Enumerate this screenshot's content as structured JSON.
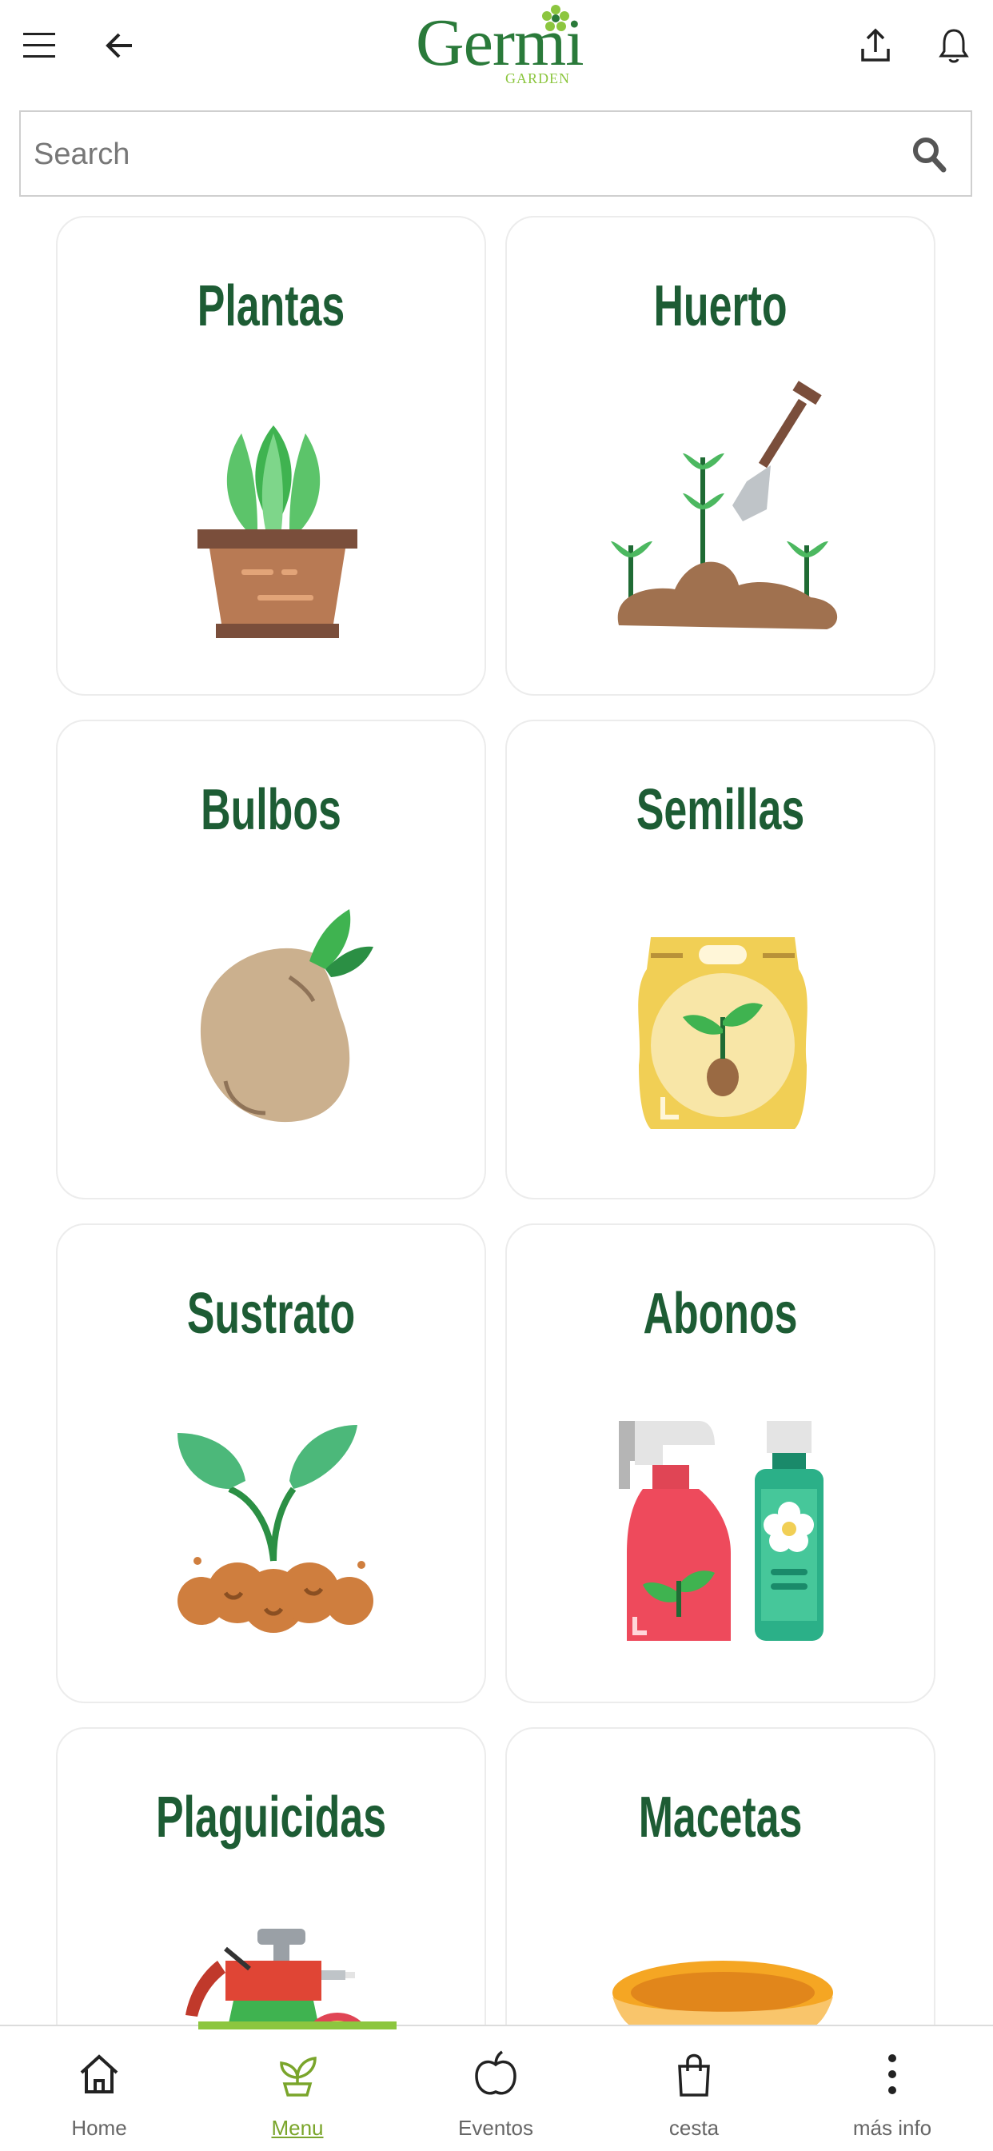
{
  "header": {
    "menu_icon": "hamburger-icon",
    "back_icon": "arrow-left-icon",
    "logo_text": "Germi",
    "logo_sub": "GARDEN",
    "share_icon": "upload-icon",
    "bell_icon": "bell-icon"
  },
  "search": {
    "placeholder": "Search",
    "value": "",
    "icon": "search-icon"
  },
  "categories": [
    {
      "label": "Plantas",
      "icon": "potted-plant-icon"
    },
    {
      "label": "Huerto",
      "icon": "garden-shovel-icon"
    },
    {
      "label": "Bulbos",
      "icon": "bulb-icon"
    },
    {
      "label": "Semillas",
      "icon": "seed-bag-icon"
    },
    {
      "label": "Sustrato",
      "icon": "sprout-soil-icon"
    },
    {
      "label": "Abonos",
      "icon": "fertilizer-bottles-icon"
    },
    {
      "label": "Plaguicidas",
      "icon": "pesticide-sprayer-icon"
    },
    {
      "label": "Macetas",
      "icon": "pot-icon"
    }
  ],
  "bottom_nav": {
    "items": [
      {
        "label": "Home",
        "icon": "home-icon"
      },
      {
        "label": "Menu",
        "icon": "sprout-icon"
      },
      {
        "label": "Eventos",
        "icon": "apple-icon"
      },
      {
        "label": "cesta",
        "icon": "shopping-bag-icon"
      },
      {
        "label": "más info",
        "icon": "more-vertical-icon"
      }
    ],
    "active_index": 1
  },
  "colors": {
    "brand_green": "#2a7a3a",
    "accent_green": "#8cc63f",
    "title_green": "#1d5c34"
  }
}
